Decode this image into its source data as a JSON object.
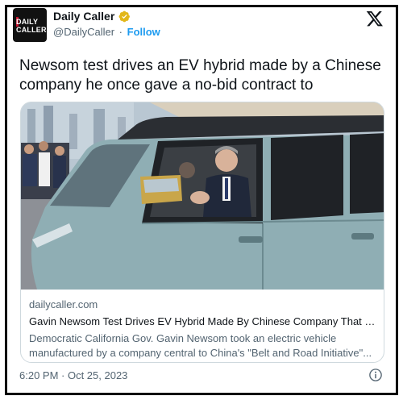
{
  "account": {
    "display_name": "Daily Caller",
    "handle": "@DailyCaller",
    "separator": "·",
    "follow_label": "Follow",
    "avatar_line1": "DAILY",
    "avatar_line2": "CALLER"
  },
  "tweet": {
    "text": "Newsom test drives an EV hybrid made by a Chinese company he once gave a no-bid contract to",
    "timestamp": "6:20 PM · Oct 25, 2023"
  },
  "card": {
    "domain": "dailycaller.com",
    "title": "Gavin Newsom Test Drives EV Hybrid Made By Chinese Company That H...",
    "description": "Democratic California Gov. Gavin Newsom took an electric vehicle manufactured by a company central to China's \"Belt and Road Initiative\"..."
  },
  "icons": {
    "verified": "verified-gold-badge-icon",
    "logo": "x-logo-icon",
    "info": "info-icon"
  },
  "colors": {
    "link_blue": "#1d9bf0",
    "verified_gold": "#e2b719",
    "text_primary": "#0f1419",
    "text_secondary": "#536471",
    "card_border": "#cfd9de"
  }
}
